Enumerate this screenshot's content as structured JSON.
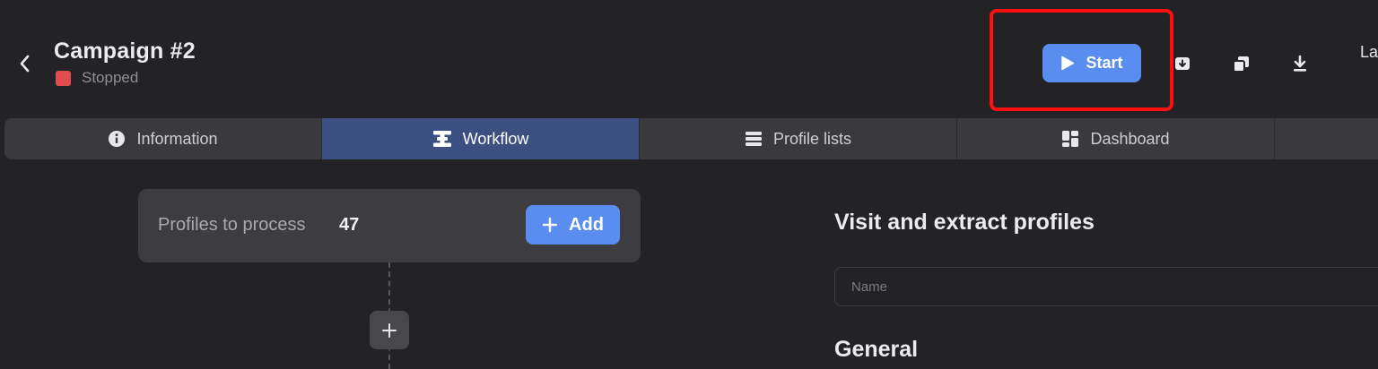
{
  "header": {
    "title": "Campaign #2",
    "status": "Stopped",
    "start_label": "Start",
    "truncated_label": "La"
  },
  "tabs": [
    {
      "label": "Information",
      "icon": "info-icon"
    },
    {
      "label": "Workflow",
      "icon": "workflow-icon",
      "active": true
    },
    {
      "label": "Profile lists",
      "icon": "list-icon"
    },
    {
      "label": "Dashboard",
      "icon": "dashboard-icon"
    },
    {
      "label": ""
    }
  ],
  "workflow": {
    "node_label": "Profiles to process",
    "node_count": "47",
    "add_label": "Add"
  },
  "panel": {
    "title": "Visit and extract profiles",
    "name_placeholder": "Name",
    "name_value": "",
    "section_title": "General"
  },
  "colors": {
    "background": "#232325",
    "accent": "#5a8df0",
    "active_tab": "#3b4f82",
    "status_stopped": "#e14d4d",
    "highlight": "#ff1010"
  }
}
